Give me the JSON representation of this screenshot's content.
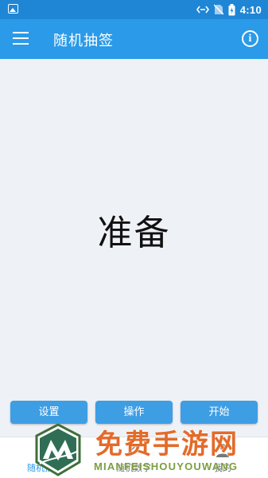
{
  "status_bar": {
    "time": "4:10"
  },
  "app_bar": {
    "title": "随机抽签"
  },
  "main": {
    "display_text": "准备"
  },
  "buttons": {
    "settings": "设置",
    "operate": "操作",
    "start": "开始"
  },
  "bottom_nav": {
    "items": [
      {
        "label": "随机抽签",
        "icon": "shuffle-icon",
        "active": true
      },
      {
        "label": "随机数字",
        "icon": "edit-icon",
        "active": false
      },
      {
        "label": "我的",
        "icon": "person-icon",
        "active": false
      }
    ]
  },
  "watermark": {
    "cn": "免费手游网",
    "en": "MIANFEISHOUYOUWANG"
  },
  "colors": {
    "status_bar": "#1f86d6",
    "app_bar": "#2b9ae8",
    "button": "#3e9ee4",
    "background": "#eef1f6"
  }
}
